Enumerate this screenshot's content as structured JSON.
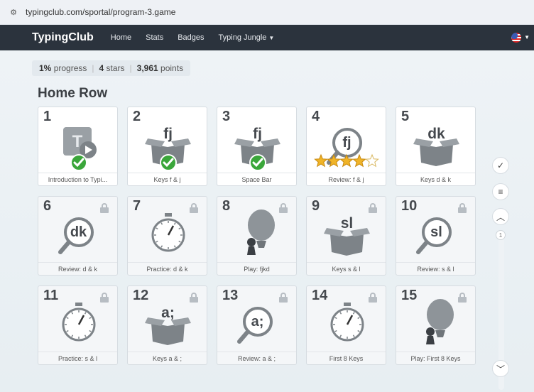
{
  "browser": {
    "url": "typingclub.com/sportal/program-3.game"
  },
  "nav": {
    "brand": "TypingClub",
    "links": [
      "Home",
      "Stats",
      "Badges",
      "Typing Jungle"
    ]
  },
  "progress": {
    "percent": "1%",
    "percent_label": "progress",
    "stars": "4",
    "stars_label": "stars",
    "points": "3,961",
    "points_label": "points"
  },
  "section": {
    "title": "Home Row"
  },
  "lessons": [
    {
      "num": "1",
      "label": "Introduction to Typi...",
      "icon": "intro-video-icon",
      "locked": false,
      "done": true
    },
    {
      "num": "2",
      "label": "Keys f & j",
      "key_text": "fj",
      "icon": "box-icon",
      "locked": false,
      "done": true
    },
    {
      "num": "3",
      "label": "Space Bar",
      "key_text": "fj",
      "icon": "box-icon",
      "locked": false,
      "done": true
    },
    {
      "num": "4",
      "label": "Review: f & j",
      "key_text": "fj",
      "icon": "magnifier-icon",
      "locked": false,
      "stars": 4
    },
    {
      "num": "5",
      "label": "Keys d & k",
      "key_text": "dk",
      "icon": "box-icon",
      "locked": false
    },
    {
      "num": "6",
      "label": "Review: d & k",
      "key_text": "dk",
      "icon": "magnifier-icon",
      "locked": true
    },
    {
      "num": "7",
      "label": "Practice: d & k",
      "icon": "stopwatch-icon",
      "locked": true
    },
    {
      "num": "8",
      "label": "Play: fjkd",
      "icon": "balloon-game-icon",
      "locked": true
    },
    {
      "num": "9",
      "label": "Keys s & l",
      "key_text": "sl",
      "icon": "box-icon",
      "locked": true
    },
    {
      "num": "10",
      "label": "Review: s & l",
      "key_text": "sl",
      "icon": "magnifier-icon",
      "locked": true
    },
    {
      "num": "11",
      "label": "Practice: s & l",
      "icon": "stopwatch-icon",
      "locked": true
    },
    {
      "num": "12",
      "label": "Keys a & ;",
      "key_text": "a;",
      "icon": "box-icon",
      "locked": true
    },
    {
      "num": "13",
      "label": "Review: a & ;",
      "key_text": "a;",
      "icon": "magnifier-icon",
      "locked": true
    },
    {
      "num": "14",
      "label": "First 8 Keys",
      "icon": "stopwatch-icon",
      "locked": true
    },
    {
      "num": "15",
      "label": "Play: First 8 Keys",
      "icon": "balloon-game-icon",
      "locked": true
    }
  ],
  "side": {
    "page": "1"
  },
  "colors": {
    "nav": "#2b333d",
    "check": "#3aa63a",
    "star": "#f0b428",
    "icon_gray": "#7d8388"
  }
}
